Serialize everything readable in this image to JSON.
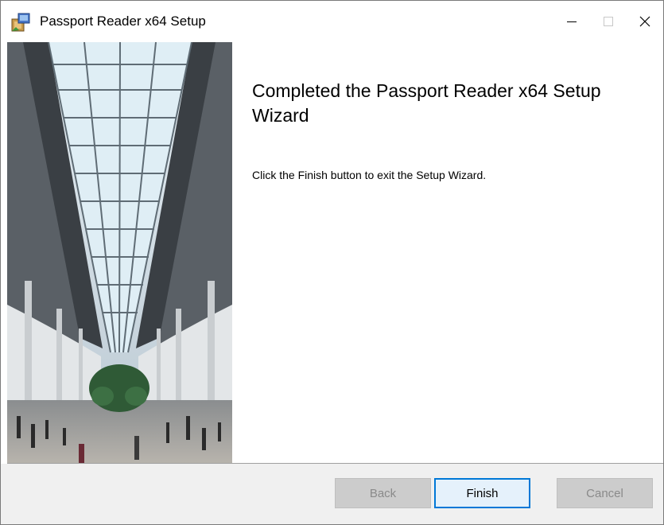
{
  "window": {
    "title": "Passport Reader x64 Setup",
    "icon": "installer-package-icon"
  },
  "main": {
    "heading": "Completed the Passport Reader x64 Setup Wizard",
    "message": "Click the Finish button to exit the Setup Wizard."
  },
  "side_image": {
    "icon": "airport-terminal-photo"
  },
  "buttons": {
    "back": "Back",
    "finish": "Finish",
    "cancel": "Cancel"
  },
  "colors": {
    "accent": "#0078d7",
    "footer_bg": "#f0f0f0",
    "disabled_text": "#8a8a8a"
  }
}
